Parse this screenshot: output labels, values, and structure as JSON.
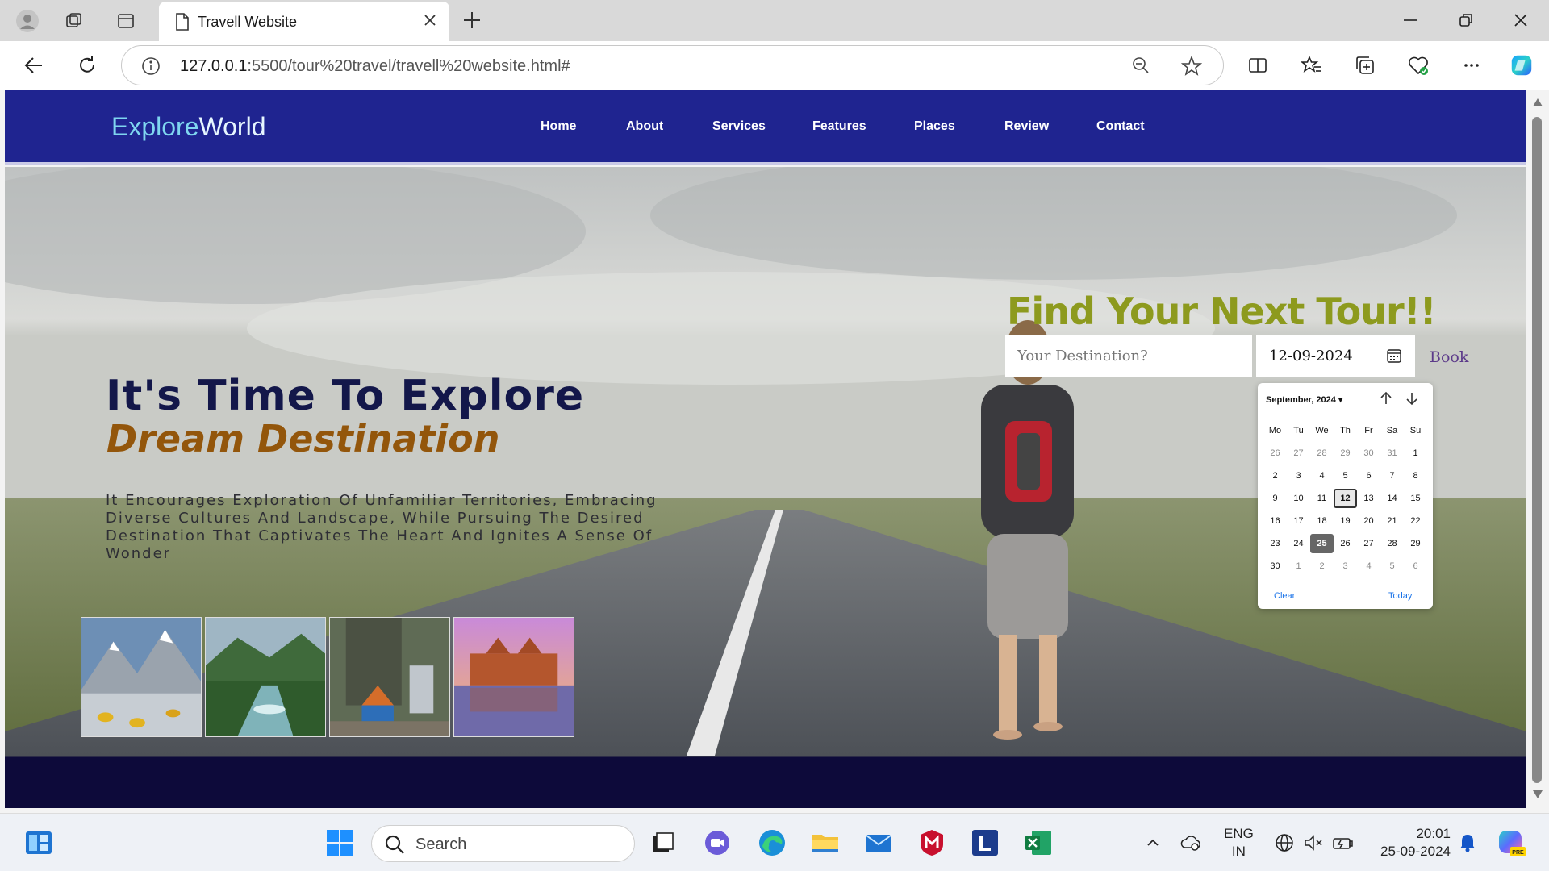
{
  "browser": {
    "tab_title": "Travell Website",
    "url_host": "127.0.0.1",
    "url_rest": ":5500/tour%20travel/travell%20website.html#"
  },
  "site": {
    "logo_explore": "Explore",
    "logo_world": "World",
    "nav": [
      "Home",
      "About",
      "Services",
      "Features",
      "Places",
      "Review",
      "Contact"
    ],
    "headline": "It's Time To Explore",
    "subheadline": "Dream Destination",
    "description": "It Encourages Exploration Of Unfamiliar Territories, Embracing Diverse Cultures And Landscape, While Pursuing The Desired Destination That Captivates The Heart And Ignites A Sense Of Wonder",
    "find_title": "Find Your Next Tour!!",
    "destination_placeholder": "Your Destination?",
    "date_value": "12-09-2024",
    "book_label": "Book"
  },
  "datepicker": {
    "month_label": "September, 2024",
    "weekdays": [
      "Mo",
      "Tu",
      "We",
      "Th",
      "Fr",
      "Sa",
      "Su"
    ],
    "weeks": [
      [
        "26",
        "27",
        "28",
        "29",
        "30",
        "31",
        "1"
      ],
      [
        "2",
        "3",
        "4",
        "5",
        "6",
        "7",
        "8"
      ],
      [
        "9",
        "10",
        "11",
        "12",
        "13",
        "14",
        "15"
      ],
      [
        "16",
        "17",
        "18",
        "19",
        "20",
        "21",
        "22"
      ],
      [
        "23",
        "24",
        "25",
        "26",
        "27",
        "28",
        "29"
      ],
      [
        "30",
        "1",
        "2",
        "3",
        "4",
        "5",
        "6"
      ]
    ],
    "selected": "12",
    "today": "25",
    "clear_label": "Clear",
    "today_label": "Today"
  },
  "taskbar": {
    "search_label": "Search",
    "lang_top": "ENG",
    "lang_bottom": "IN",
    "time": "20:01",
    "date": "25-09-2024"
  },
  "colors": {
    "navbar": "#1f2490",
    "headline": "#13174a",
    "subheadline": "#93560b",
    "find_title": "#8d9a1e"
  }
}
